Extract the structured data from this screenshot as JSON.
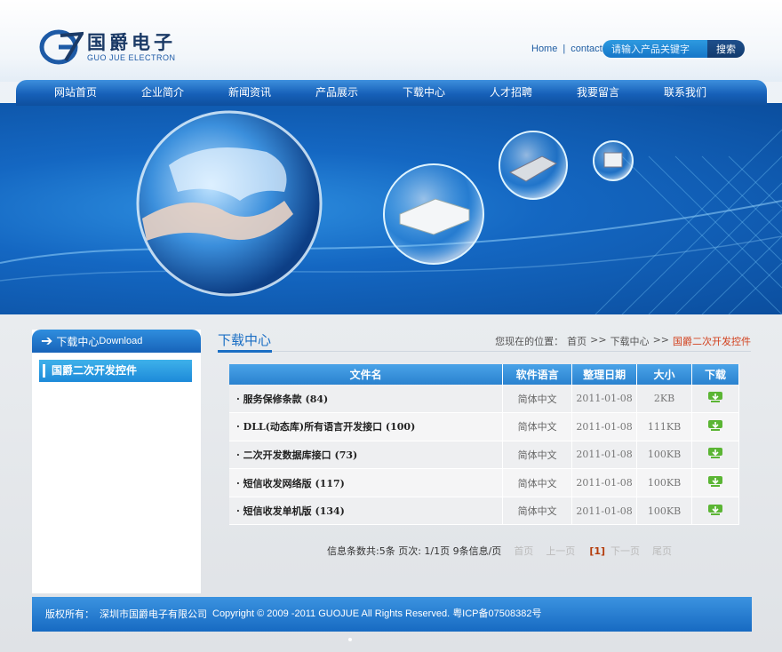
{
  "header": {
    "logo_cn": "国爵电子",
    "logo_en": "GUO JUE ELECTRON",
    "links": [
      "Home",
      "|",
      "contact"
    ],
    "search": {
      "placeholder": "请输入产品关键字",
      "button": "搜索"
    }
  },
  "nav": [
    "网站首页",
    "企业简介",
    "新闻资讯",
    "产品展示",
    "下载中心",
    "人才招聘",
    "我要留言",
    "联系我们"
  ],
  "sidebar": {
    "title_cn": "下载中心",
    "title_en": "Download",
    "items": [
      "国爵二次开发控件"
    ]
  },
  "main": {
    "title": "下载中心",
    "breadcrumb": {
      "prefix": "您现在的位置：",
      "home": "首页",
      "sep": ">>",
      "section": "下载中心",
      "current": "国爵二次开发控件"
    },
    "table": {
      "headers": [
        "文件名",
        "软件语言",
        "整理日期",
        "大小",
        "下载"
      ],
      "rows": [
        {
          "name": "· 服务保修条款 (84)",
          "lang": "简体中文",
          "date": "2011-01-08",
          "size": "2KB"
        },
        {
          "name": "· DLL(动态库)所有语言开发接口 (100)",
          "lang": "简体中文",
          "date": "2011-01-08",
          "size": "111KB"
        },
        {
          "name": "· 二次开发数据库接口 (73)",
          "lang": "简体中文",
          "date": "2011-01-08",
          "size": "100KB"
        },
        {
          "name": "· 短信收发网络版 (117)",
          "lang": "简体中文",
          "date": "2011-01-08",
          "size": "100KB"
        },
        {
          "name": "· 短信收发单机版 (134)",
          "lang": "简体中文",
          "date": "2011-01-08",
          "size": "100KB"
        }
      ]
    },
    "pager": {
      "info": "信息条数共:5条  页次: 1/1页   9条信息/页",
      "first": "首页",
      "prev": "上一页",
      "current": "[1]",
      "next": "下一页",
      "last": "尾页"
    }
  },
  "footer": {
    "label": "版权所有：",
    "company": "深圳市国爵电子有限公司",
    "copyright": "Copyright © 2009 -2011 GUOJUE All Rights Reserved. 粤ICP备07508382号"
  },
  "colors": {
    "brand_blue": "#1660b8",
    "accent_red": "#d2401c",
    "download_green": "#5bb534"
  }
}
